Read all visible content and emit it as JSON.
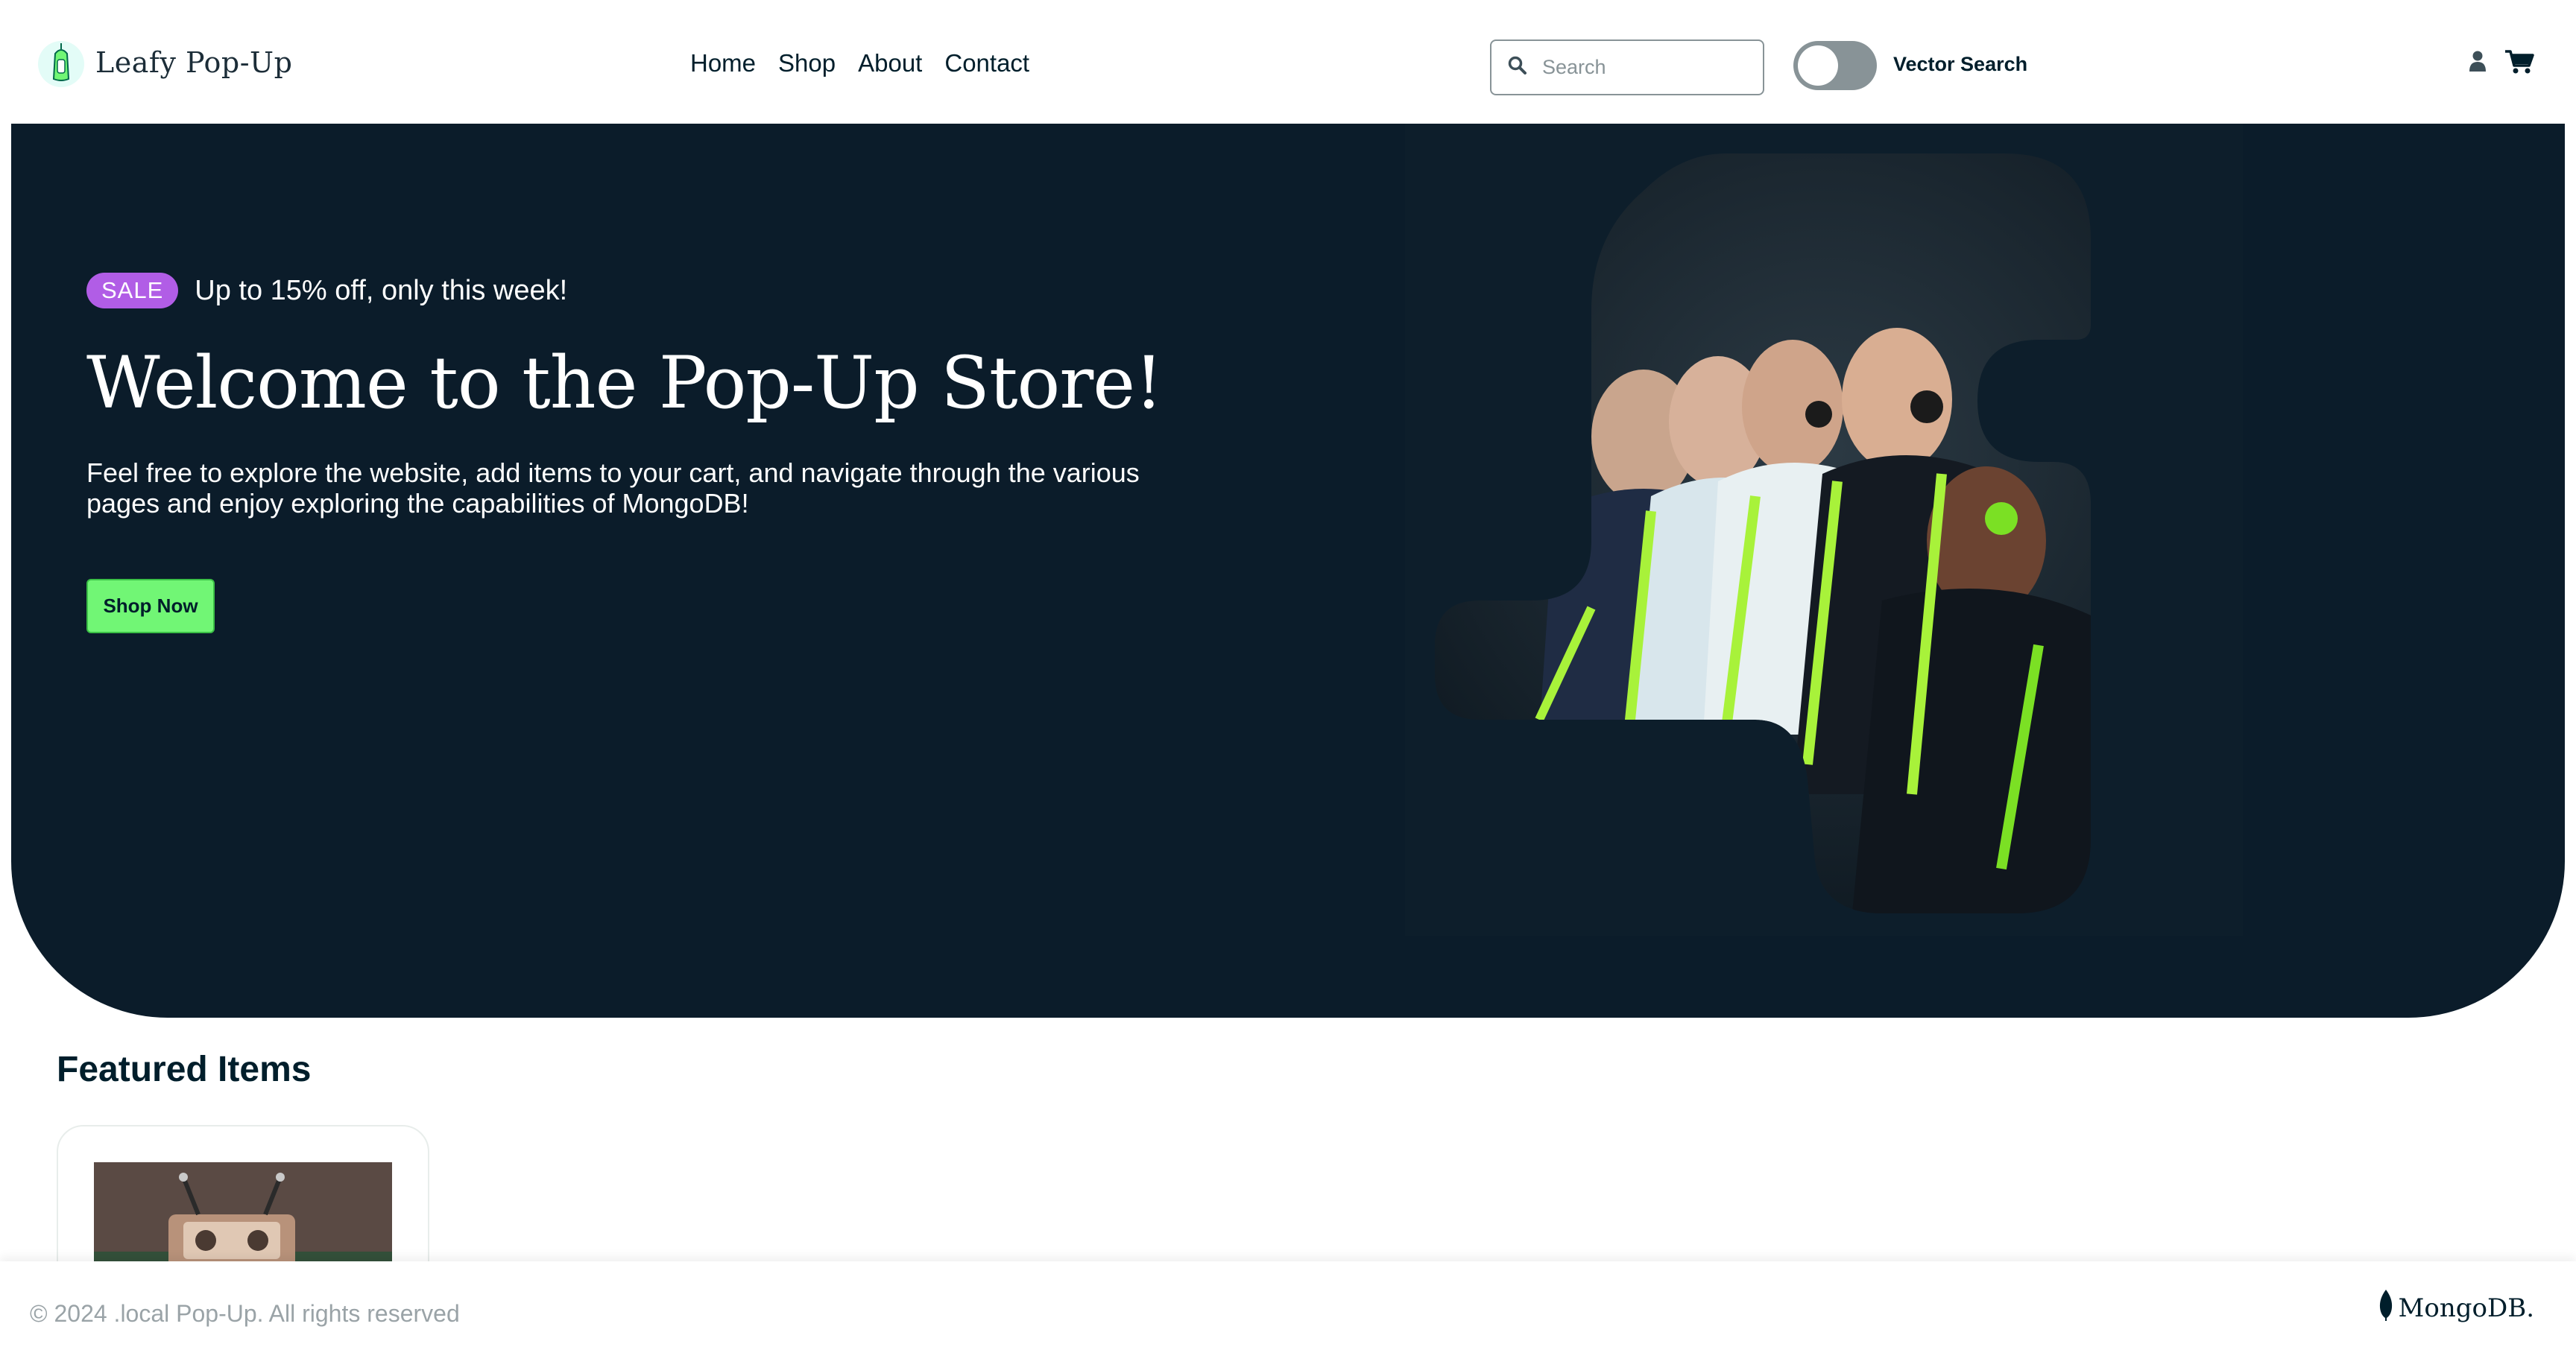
{
  "header": {
    "brand": "Leafy Pop-Up",
    "nav": [
      "Home",
      "Shop",
      "About",
      "Contact"
    ],
    "search_placeholder": "Search",
    "toggle_label": "Vector Search",
    "toggle_on": false
  },
  "hero": {
    "badge": "SALE",
    "sale_text": "Up to 15% off, only this week!",
    "title": "Welcome to the Pop-Up Store!",
    "description": "Feel free to explore the website, add items to your cart, and navigate through the various pages and enjoy exploring the capabilities of MongoDB!",
    "cta": "Shop Now"
  },
  "featured": {
    "title": "Featured Items"
  },
  "footer": {
    "copyright": "© 2024 .local Pop-Up. All rights reserved",
    "logo_text": "MongoDB."
  },
  "colors": {
    "hero_bg": "#0b1c2a",
    "accent_green": "#71f675",
    "badge_purple": "#b15de6",
    "text_dark": "#001e2b"
  },
  "icons": {
    "search": "search-icon",
    "user": "user-icon",
    "cart": "cart-icon",
    "logo": "leaf-lantern-icon",
    "footer_logo": "mongodb-leaf-icon"
  }
}
